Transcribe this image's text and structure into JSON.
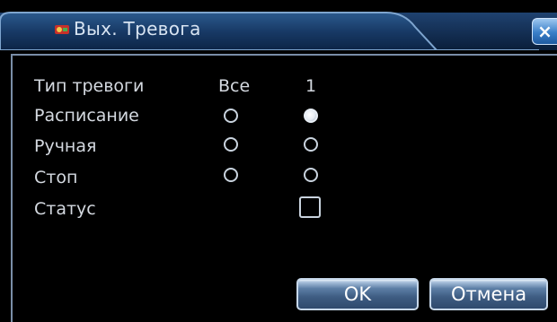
{
  "dialog": {
    "title": "Вых. Тревога",
    "close_label": "×"
  },
  "columns": {
    "all": "Все",
    "one": "1"
  },
  "rows": [
    {
      "label": "Тип тревоги"
    },
    {
      "label": "Расписание",
      "all_selected": false,
      "one_selected": true
    },
    {
      "label": "Ручная",
      "all_selected": false,
      "one_selected": false
    },
    {
      "label": "Стоп",
      "all_selected": false,
      "one_selected": false
    },
    {
      "label": "Статус",
      "status_checked": false
    }
  ],
  "buttons": {
    "ok": "OK",
    "cancel": "Отмена"
  },
  "colors": {
    "title_bar": "#2a5a8c",
    "background": "#000000",
    "text": "#d4d9e0",
    "accent": "#3a7fc8"
  }
}
